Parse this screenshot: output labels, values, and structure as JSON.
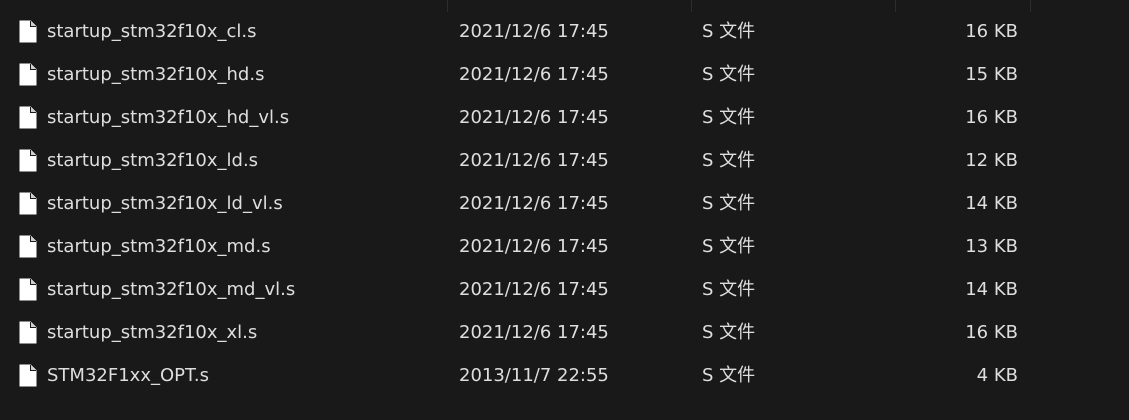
{
  "files": [
    {
      "name": "startup_stm32f10x_cl.s",
      "date": "2021/12/6 17:45",
      "type": "S 文件",
      "size": "16 KB",
      "icon": "file-icon"
    },
    {
      "name": "startup_stm32f10x_hd.s",
      "date": "2021/12/6 17:45",
      "type": "S 文件",
      "size": "15 KB",
      "icon": "file-icon"
    },
    {
      "name": "startup_stm32f10x_hd_vl.s",
      "date": "2021/12/6 17:45",
      "type": "S 文件",
      "size": "16 KB",
      "icon": "file-icon"
    },
    {
      "name": "startup_stm32f10x_ld.s",
      "date": "2021/12/6 17:45",
      "type": "S 文件",
      "size": "12 KB",
      "icon": "file-icon"
    },
    {
      "name": "startup_stm32f10x_ld_vl.s",
      "date": "2021/12/6 17:45",
      "type": "S 文件",
      "size": "14 KB",
      "icon": "file-icon"
    },
    {
      "name": "startup_stm32f10x_md.s",
      "date": "2021/12/6 17:45",
      "type": "S 文件",
      "size": "13 KB",
      "icon": "file-icon"
    },
    {
      "name": "startup_stm32f10x_md_vl.s",
      "date": "2021/12/6 17:45",
      "type": "S 文件",
      "size": "14 KB",
      "icon": "file-icon"
    },
    {
      "name": "startup_stm32f10x_xl.s",
      "date": "2021/12/6 17:45",
      "type": "S 文件",
      "size": "16 KB",
      "icon": "file-icon"
    },
    {
      "name": "STM32F1xx_OPT.s",
      "date": "2013/11/7 22:55",
      "type": "S 文件",
      "size": "4 KB",
      "icon": "file-icon"
    }
  ],
  "colors": {
    "background": "#191919",
    "text": "#dedede",
    "icon_fill": "#ffffff",
    "divider": "#2d2d2d"
  }
}
